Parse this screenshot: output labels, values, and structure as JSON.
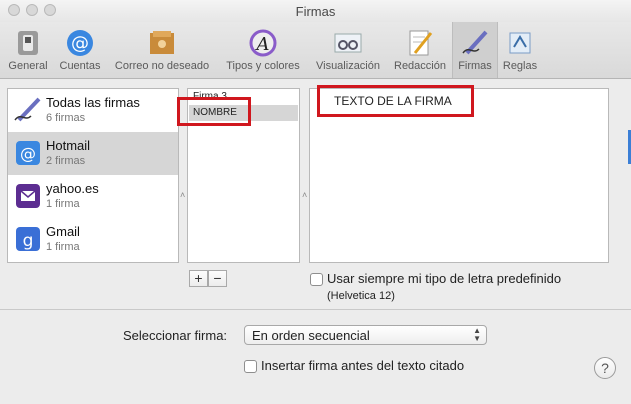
{
  "window": {
    "title": "Firmas"
  },
  "toolbar": {
    "items": [
      {
        "label": "General",
        "icon": "switch-icon"
      },
      {
        "label": "Cuentas",
        "icon": "at-sign-icon"
      },
      {
        "label": "Correo no deseado",
        "icon": "junk-mail-icon"
      },
      {
        "label": "Tipos y colores",
        "icon": "font-palette-icon"
      },
      {
        "label": "Visualización",
        "icon": "viewing-glasses-icon"
      },
      {
        "label": "Redacción",
        "icon": "notepad-pencil-icon"
      },
      {
        "label": "Firmas",
        "icon": "signature-pen-icon"
      },
      {
        "label": "Reglas",
        "icon": "rules-icon"
      }
    ],
    "active": "Firmas"
  },
  "accounts": [
    {
      "name": "Todas las firmas",
      "count": "6 firmas",
      "icon": "signature-pen-icon"
    },
    {
      "name": "Hotmail",
      "count": "2 firmas",
      "icon": "at-sign-icon"
    },
    {
      "name": "yahoo.es",
      "count": "1 firma",
      "icon": "envelope-icon",
      "color": "#5c2d91"
    },
    {
      "name": "Gmail",
      "count": "1 firma",
      "icon": "google-icon",
      "color": "#3a6fd6"
    }
  ],
  "signatures": {
    "items": [
      "Firma 3",
      "NOMBRE"
    ],
    "selected": "NOMBRE"
  },
  "signature_text": "TEXTO DE LA FIRMA",
  "buttons": {
    "add": "+",
    "remove": "−"
  },
  "font_option": {
    "label": "Usar siempre mi tipo de letra predefinido",
    "font": "(Helvetica 12)"
  },
  "choose_signature": {
    "label": "Seleccionar firma:",
    "value": "En orden secuencial"
  },
  "insert_before": {
    "label": "Insertar firma antes del texto citado"
  },
  "help": "?",
  "colors": {
    "annotation": "#d0171e"
  }
}
